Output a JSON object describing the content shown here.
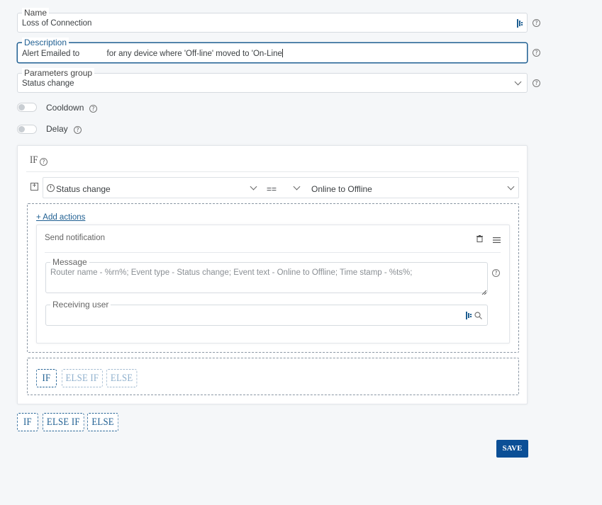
{
  "form": {
    "name": {
      "label": "Name",
      "value": "Loss of Connection"
    },
    "description": {
      "label": "Description",
      "value": "Alert Emailed to            for any device where 'Off-line' moved to 'On-Line"
    },
    "parameters_group": {
      "label": "Parameters group",
      "value": "Status change"
    },
    "cooldown": {
      "label": "Cooldown",
      "enabled": false
    },
    "delay": {
      "label": "Delay",
      "enabled": false
    }
  },
  "condition": {
    "title": "IF",
    "parameter": "Status change",
    "operator": "==",
    "value": "Online to Offline"
  },
  "actions": {
    "add_label": "+ Add actions",
    "item": {
      "title": "Send notification",
      "message": {
        "label": "Message",
        "placeholder": "Router name - %rn%; Event type - Status change; Event text - Online to Offline; Time stamp - %ts%;"
      },
      "receiving_user": {
        "label": "Receiving user",
        "value": ""
      }
    }
  },
  "inner_branches": {
    "if": "IF",
    "else_if": "ELSE IF",
    "else": "ELSE"
  },
  "outer_branches": {
    "if": "IF",
    "else_if": "ELSE IF",
    "else": "ELSE"
  },
  "save_label": "SAVE",
  "colors": {
    "accent": "#1f5f92",
    "save_bg": "#0b4f96"
  }
}
